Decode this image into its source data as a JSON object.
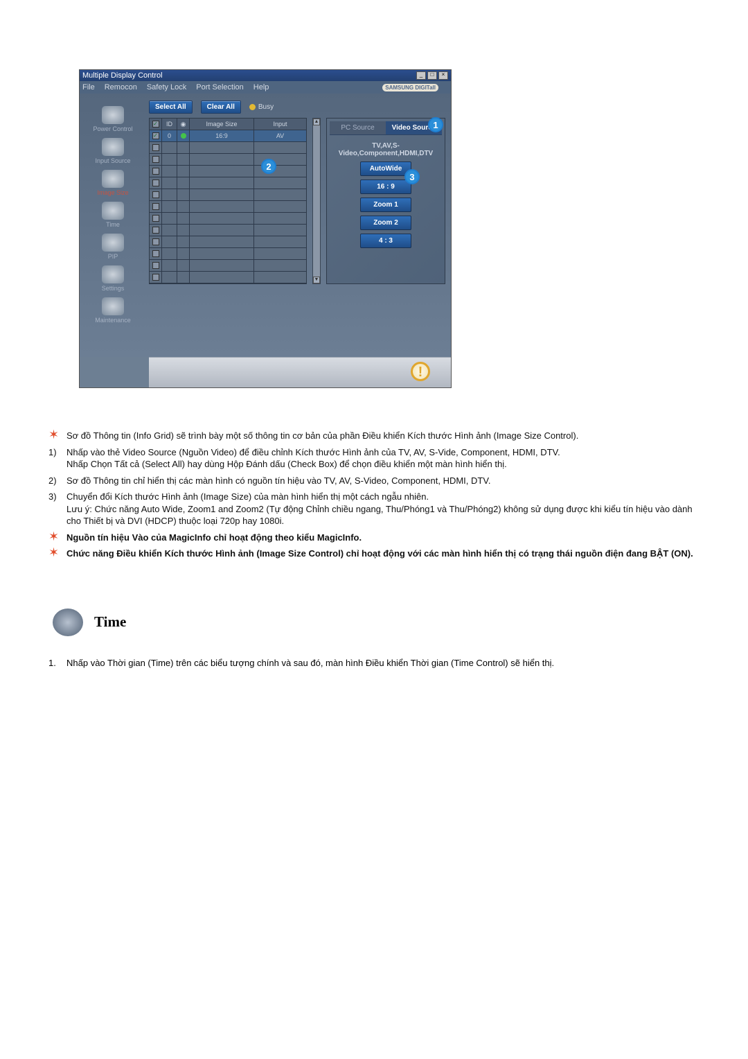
{
  "window": {
    "title": "Multiple Display Control",
    "menu": [
      "File",
      "Remocon",
      "Safety Lock",
      "Port Selection",
      "Help"
    ],
    "brand": "SAMSUNG DIGITall"
  },
  "sidebar": {
    "items": [
      {
        "label": "Power Control"
      },
      {
        "label": "Input Source"
      },
      {
        "label": "Image Size"
      },
      {
        "label": "Time"
      },
      {
        "label": "PIP"
      },
      {
        "label": "Settings"
      },
      {
        "label": "Maintenance"
      }
    ]
  },
  "buttons": {
    "select_all": "Select All",
    "clear_all": "Clear All",
    "busy": "Busy"
  },
  "grid": {
    "headers": {
      "ck": "✓",
      "id": "ID",
      "st": "",
      "size": "Image Size",
      "input": "Input"
    },
    "row0": {
      "id": "0",
      "size": "16:9",
      "input": "AV"
    }
  },
  "tabs": {
    "pc": "PC Source",
    "video": "Video Source"
  },
  "src_label": "TV,AV,S-Video,Component,HDMI,DTV",
  "opts": [
    "AutoWide",
    "16 : 9",
    "Zoom 1",
    "Zoom 2",
    "4 : 3"
  ],
  "callouts": {
    "c1": "1",
    "c2": "2",
    "c3": "3"
  },
  "notes": {
    "n0": "Sơ đồ Thông tin (Info Grid) sẽ trình bày một số thông tin cơ bản của phần Điều khiển Kích thước Hình ảnh (Image Size Control).",
    "n1a": "Nhấp vào thẻ Video Source (Nguồn Video) để điều chỉnh Kích thước Hình ảnh của TV, AV, S-Vide, Component, HDMI, DTV.",
    "n1b": "Nhấp Chọn Tất cả (Select All) hay dùng Hộp Đánh dấu (Check Box) để chọn điều khiển một màn hình hiển thị.",
    "n2": "Sơ đồ Thông tin chỉ hiển thị các màn hình có nguồn tín hiệu vào TV, AV, S-Video, Component, HDMI, DTV.",
    "n3a": "Chuyển đổi Kích thước Hình ảnh (Image Size) của màn hình hiển thị một cách ngẫu nhiên.",
    "n3b": "Lưu ý: Chức năng Auto Wide, Zoom1 and Zoom2 (Tự động Chỉnh chiều ngang, Thu/Phóng1 và Thu/Phóng2) không sử dụng được khi kiểu tín hiệu vào dành cho Thiết bị và DVI (HDCP) thuộc loại 720p hay 1080i.",
    "n4": "Nguồn tín hiệu Vào của MagicInfo chỉ hoạt động theo kiểu MagicInfo.",
    "n5": "Chức năng Điều khiển Kích thước Hình ảnh (Image Size Control) chỉ hoạt động với các màn hình hiển thị có trạng thái nguồn điện đang BẬT (ON).",
    "markers": {
      "m1": "1)",
      "m2": "2)",
      "m3": "3)"
    }
  },
  "section": {
    "title": "Time",
    "bullet1_marker": "1.",
    "bullet1": "Nhấp vào Thời gian (Time) trên các biểu tượng chính và sau đó, màn hình Điều khiển Thời gian (Time Control) sẽ hiển thị."
  }
}
